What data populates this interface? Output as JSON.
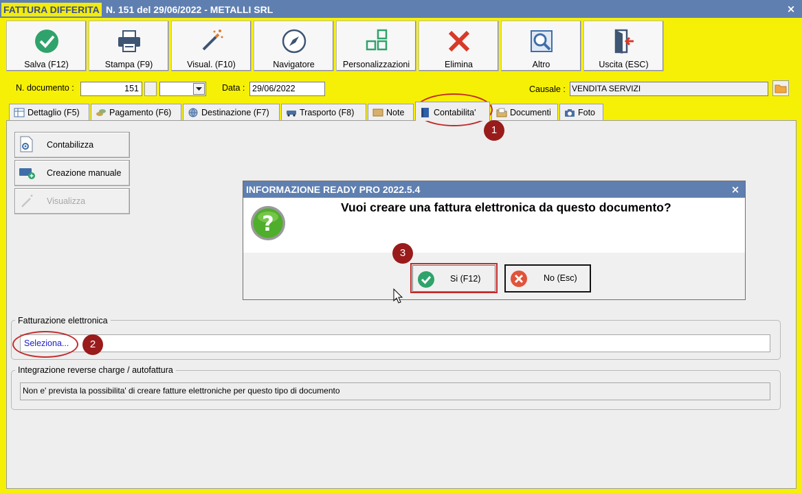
{
  "window": {
    "title_highlight": "FATTURA DIFFERITA",
    "title_rest": "N. 151 del 29/06/2022 - METALLI SRL",
    "close_glyph": "×"
  },
  "toolbar": [
    {
      "label": "Salva (F12)",
      "icon": "check-circle-icon"
    },
    {
      "label": "Stampa (F9)",
      "icon": "printer-icon"
    },
    {
      "label": "Visual. (F10)",
      "icon": "magic-wand-icon"
    },
    {
      "label": "Navigatore",
      "icon": "compass-icon"
    },
    {
      "label": "Personalizzazioni",
      "icon": "grid-squares-icon"
    },
    {
      "label": "Elimina",
      "icon": "red-x-icon"
    },
    {
      "label": "Altro",
      "icon": "magnifier-icon"
    },
    {
      "label": "Uscita (ESC)",
      "icon": "exit-door-icon"
    }
  ],
  "header": {
    "doc_label": "N. documento :",
    "doc_number": "151",
    "date_label": "Data :",
    "date_value": "29/06/2022",
    "causale_label": "Causale :",
    "causale_value": "VENDITA SERVIZI"
  },
  "tabs": [
    {
      "label": "Dettaglio (F5)"
    },
    {
      "label": "Pagamento (F6)"
    },
    {
      "label": "Destinazione (F7)"
    },
    {
      "label": "Trasporto (F8)"
    },
    {
      "label": "Note"
    },
    {
      "label": "Contabilita'"
    },
    {
      "label": "Documenti"
    },
    {
      "label": "Foto"
    }
  ],
  "active_tab": "Contabilita'",
  "actions": {
    "contabilizza": "Contabilizza",
    "creazione_manuale": "Creazione manuale",
    "visualizza": "Visualizza"
  },
  "fattura_elettronica": {
    "group_label": "Fatturazione elettronica",
    "link_text": "Seleziona..."
  },
  "reverse_charge": {
    "group_label": "Integrazione reverse charge / autofattura",
    "message": "Non e' prevista la possibilita' di creare fatture elettroniche per questo tipo di documento"
  },
  "dialog": {
    "title": "INFORMAZIONE READY PRO 2022.5.4",
    "message": "Vuoi creare una fattura elettronica da questo documento?",
    "yes_label": "Si (F12)",
    "no_label": "No (Esc)",
    "close_glyph": "×"
  },
  "annotations": {
    "m1": "1",
    "m2": "2",
    "m3": "3"
  },
  "colors": {
    "window_background": "#f6f006",
    "titlebar": "#5f7fb0",
    "annotation": "#9a1b1b",
    "link": "#1a1acc"
  }
}
